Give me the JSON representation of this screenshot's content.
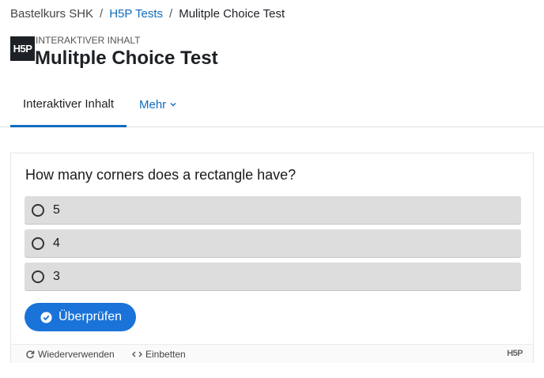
{
  "breadcrumb": {
    "items": [
      "Bastelkurs SHK",
      "H5P Tests",
      "Mulitple Choice Test"
    ],
    "separator": "/"
  },
  "header": {
    "logo_text": "H5P",
    "module_type": "INTERAKTIVER INHALT",
    "title": "Mulitple Choice Test"
  },
  "tabs": {
    "active_label": "Interaktiver Inhalt",
    "more_label": "Mehr"
  },
  "h5p": {
    "question": "How many corners does a rectangle have?",
    "answers": [
      "5",
      "4",
      "3"
    ],
    "check_label": "Überprüfen",
    "footer": {
      "reuse_label": "Wiederverwenden",
      "embed_label": "Einbetten",
      "logo_text": "H5P"
    }
  },
  "colors": {
    "link": "#0f6cbf",
    "button": "#1a73d9",
    "answer_bg": "#dddddd"
  }
}
